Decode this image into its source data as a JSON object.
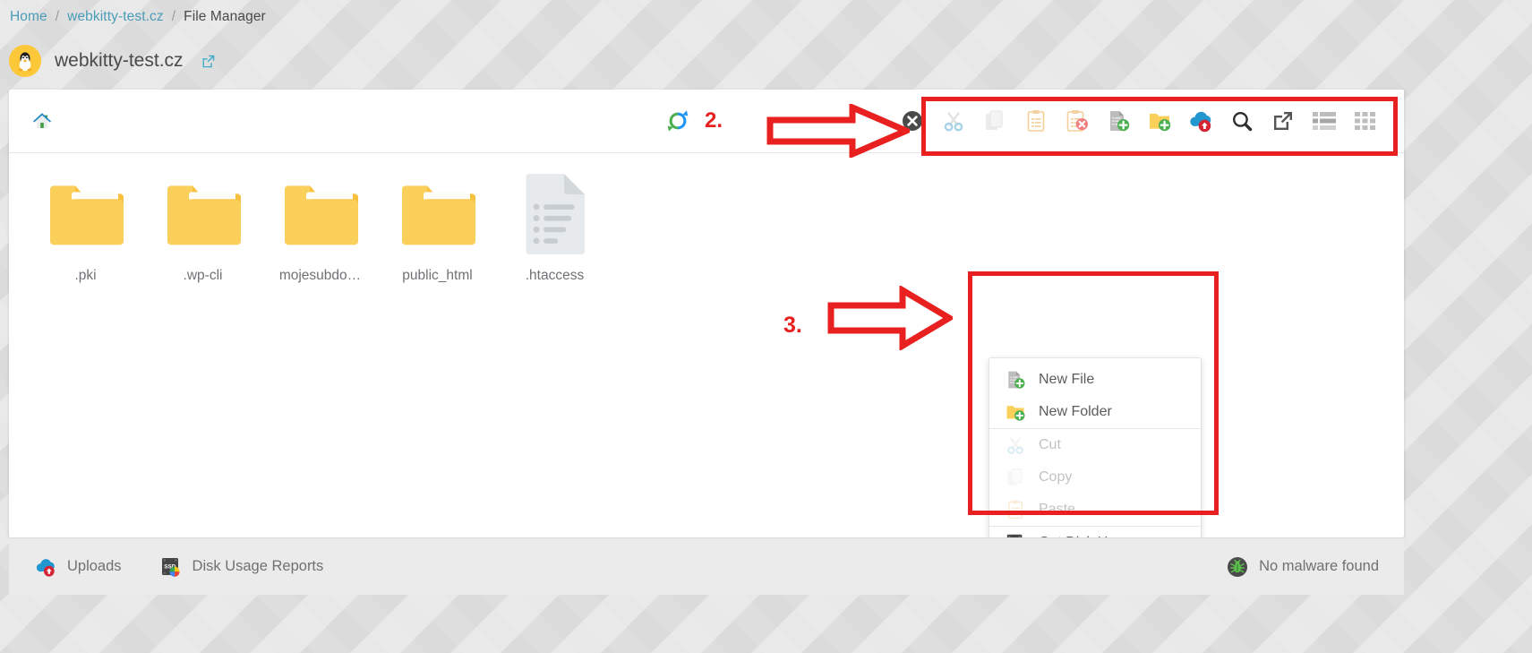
{
  "breadcrumb": {
    "items": [
      {
        "label": "Home",
        "link": true
      },
      {
        "label": "webkitty-test.cz",
        "link": true
      },
      {
        "label": "File Manager",
        "link": false
      }
    ],
    "separator": "/"
  },
  "site_header": {
    "title": "webkitty-test.cz",
    "avatar_icon": "linux-penguin-icon",
    "open_external_icon": "external-link-icon"
  },
  "toolbar": {
    "home_icon": "home-icon",
    "refresh_icon": "refresh-icon",
    "step_label": "2.",
    "buttons": [
      {
        "name": "deselect-all-button",
        "icon": "circle-x-icon",
        "label": "Deselect All",
        "enabled": true
      },
      {
        "name": "cut-button",
        "icon": "scissors-icon",
        "label": "Cut",
        "enabled": false
      },
      {
        "name": "copy-button",
        "icon": "copy-pages-icon",
        "label": "Copy",
        "enabled": false
      },
      {
        "name": "paste-button",
        "icon": "clipboard-icon",
        "label": "Paste",
        "enabled": false
      },
      {
        "name": "clear-clipboard-button",
        "icon": "clipboard-x-icon",
        "label": "Clear Clipboard",
        "enabled": false
      },
      {
        "name": "new-file-button",
        "icon": "file-plus-icon",
        "label": "New File",
        "enabled": true
      },
      {
        "name": "new-folder-button",
        "icon": "folder-plus-icon",
        "label": "New Folder",
        "enabled": true
      },
      {
        "name": "upload-button",
        "icon": "cloud-upload-icon",
        "label": "Upload",
        "enabled": true
      },
      {
        "name": "search-button",
        "icon": "magnifier-icon",
        "label": "Search",
        "enabled": true
      },
      {
        "name": "open-external-button",
        "icon": "external-link-icon",
        "label": "Open",
        "enabled": true
      },
      {
        "name": "list-view-button",
        "icon": "list-view-icon",
        "label": "List View",
        "enabled": true
      },
      {
        "name": "grid-view-button",
        "icon": "grid-view-icon",
        "label": "Grid View",
        "enabled": true
      }
    ]
  },
  "files": [
    {
      "name": ".pki",
      "type": "folder",
      "icon": "folder-icon"
    },
    {
      "name": ".wp-cli",
      "type": "folder",
      "icon": "folder-icon"
    },
    {
      "name": "mojesubdo…",
      "type": "folder",
      "icon": "folder-icon"
    },
    {
      "name": "public_html",
      "type": "folder",
      "icon": "folder-icon"
    },
    {
      "name": ".htaccess",
      "type": "file",
      "icon": "text-file-icon"
    }
  ],
  "context_menu": {
    "step_label": "3.",
    "groups": [
      {
        "items": [
          {
            "label": "New File",
            "icon": "file-plus-icon",
            "name": "ctx-new-file",
            "enabled": true
          },
          {
            "label": "New Folder",
            "icon": "folder-plus-icon",
            "name": "ctx-new-folder",
            "enabled": true
          }
        ]
      },
      {
        "items": [
          {
            "label": "Cut",
            "icon": "scissors-icon",
            "name": "ctx-cut",
            "enabled": false
          },
          {
            "label": "Copy",
            "icon": "copy-pages-icon",
            "name": "ctx-copy",
            "enabled": false
          },
          {
            "label": "Paste",
            "icon": "clipboard-icon",
            "name": "ctx-paste",
            "enabled": false
          }
        ]
      },
      {
        "items": [
          {
            "label": "Get Disk Usage",
            "icon": "ssd-disk-icon",
            "name": "ctx-get-disk-usage",
            "enabled": true
          }
        ]
      }
    ]
  },
  "footer": {
    "links": [
      {
        "label": "Uploads",
        "icon": "cloud-upload-icon",
        "name": "footer-uploads"
      },
      {
        "label": "Disk Usage Reports",
        "icon": "ssd-disk-icon",
        "name": "footer-disk-usage-reports"
      }
    ],
    "status": {
      "label": "No malware found",
      "icon": "bug-shield-icon"
    }
  },
  "colors": {
    "accent_red": "#e8201f",
    "link_blue": "#4a9cb8",
    "folder_yellow": "#fbd05a",
    "green": "#4caf50",
    "page_bg": "#dedede"
  }
}
